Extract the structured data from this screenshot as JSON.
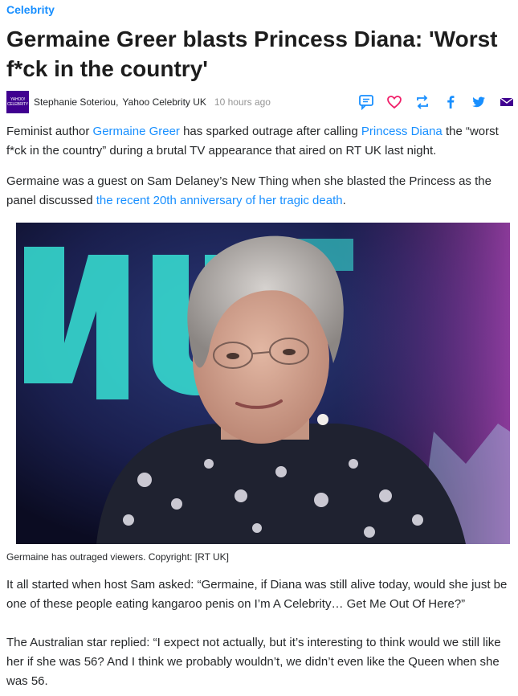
{
  "category": "Celebrity",
  "headline": "Germaine Greer blasts Princess Diana: 'Worst f*ck in the country'",
  "byline": {
    "logo_line1": "YAHOO!",
    "logo_line2": "CELEBRITY",
    "author": "Stephanie Soteriou,",
    "provider": "Yahoo Celebrity UK",
    "time": "10 hours ago"
  },
  "share_icons": [
    "comment-icon",
    "heart-icon",
    "retweet-icon",
    "facebook-icon",
    "twitter-icon",
    "mail-icon"
  ],
  "paragraphs": {
    "p1": {
      "t1": "Feminist author ",
      "link1": "Germaine Greer",
      "t2": " has sparked outrage after calling ",
      "link2": "Princess Diana",
      "t3": " the “worst f*ck in the country” during a brutal TV appearance that aired on RT UK last night."
    },
    "p2": {
      "t1": "Germaine was a guest on Sam Delaney’s New Thing when she blasted the Princess as the panel discussed ",
      "link1": "the recent 20th anniversary of her tragic death",
      "t2": "."
    },
    "p3": "It all started when host Sam asked: “Germaine, if Diana was still alive today, would she just be one of these people eating kangaroo penis on I’m A Celebrity… Get Me Out Of Here?”",
    "p4": "The Australian star replied: “I expect not actually, but it’s interesting to think would we still like her if she was 56? And I think we probably wouldn’t, we didn’t even like the Queen when she was 56."
  },
  "image": {
    "caption": "Germaine has outraged viewers. Copyright: [RT UK]"
  },
  "colors": {
    "link": "#188fff",
    "share_icon": "#188fff",
    "heart": "#f0206a",
    "mail": "#400090"
  }
}
